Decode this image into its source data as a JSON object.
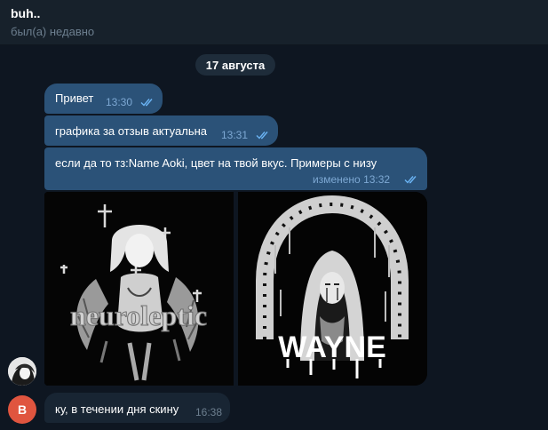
{
  "header": {
    "title": "buh..",
    "status": "был(а) недавно"
  },
  "date_separator": "17 августа",
  "messages": [
    {
      "text": "Привет",
      "time": "13:30"
    },
    {
      "text": "графика за отзыв актуальна",
      "time": "13:31"
    },
    {
      "text": "если да то тз:Name Aoki, цвет на твой вкус. Примеры с низу",
      "meta": "изменено 13:32"
    }
  ],
  "images": [
    {
      "description": "neuroleptic-artwork",
      "caption": "neuroleptic"
    },
    {
      "description": "wayne-artwork",
      "caption": "WAYNE"
    }
  ],
  "reply": {
    "avatar_letter": "B",
    "avatar_color": "#e0553f",
    "text": "ку, в течении дня скину",
    "time": "16:38"
  },
  "colors": {
    "background": "#0e1621",
    "outgoing": "#2b5278",
    "incoming": "#182533",
    "header": "#17212b"
  }
}
